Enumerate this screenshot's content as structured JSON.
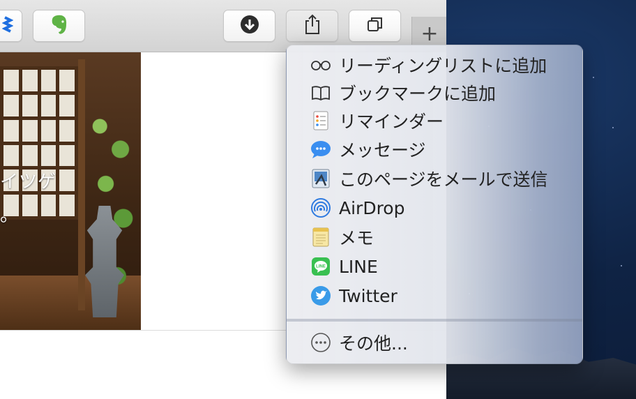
{
  "toolbar": {
    "buttons": [
      {
        "icon": "dropbox-icon"
      },
      {
        "icon": "evernote-icon",
        "color": "#5fb346"
      },
      {
        "icon": "download-icon"
      },
      {
        "icon": "share-icon"
      },
      {
        "icon": "tabs-overview-icon"
      }
    ],
    "new_tab_symbol": "+"
  },
  "page": {
    "text_lines": [
      "イツゲ",
      "。"
    ]
  },
  "share_menu": {
    "items": [
      {
        "label": "リーディングリストに追加",
        "icon": "reading-list-icon"
      },
      {
        "label": "ブックマークに追加",
        "icon": "bookmark-book-icon"
      },
      {
        "label": "リマインダー",
        "icon": "reminders-icon"
      },
      {
        "label": "メッセージ",
        "icon": "messages-icon",
        "color": "#3a8ef0"
      },
      {
        "label": "このページをメールで送信",
        "icon": "mail-icon"
      },
      {
        "label": "AirDrop",
        "icon": "airdrop-icon",
        "color": "#2f7be0"
      },
      {
        "label": "メモ",
        "icon": "notes-icon",
        "color": "#f0d36a"
      },
      {
        "label": "LINE",
        "icon": "line-icon",
        "color": "#39c051"
      },
      {
        "label": "Twitter",
        "icon": "twitter-icon",
        "color": "#3a9be8"
      }
    ],
    "more_label": "その他..."
  }
}
